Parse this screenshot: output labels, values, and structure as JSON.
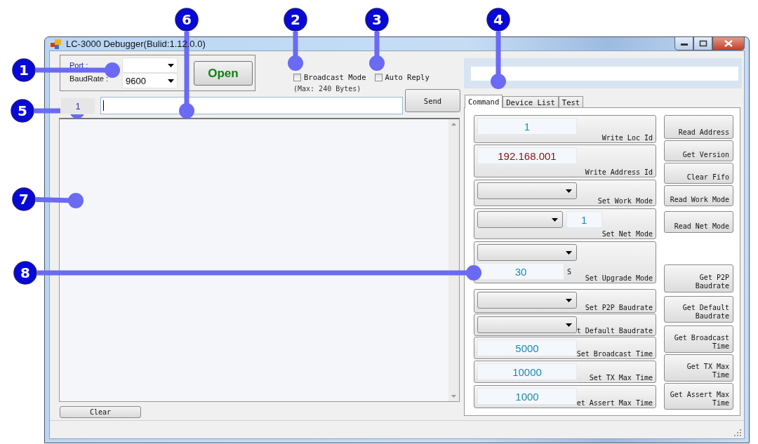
{
  "window": {
    "title": "LC-3000 Debugger(Bulid:1.12.0.0)"
  },
  "callouts": [
    {
      "label": "1"
    },
    {
      "label": "2"
    },
    {
      "label": "3"
    },
    {
      "label": "4"
    },
    {
      "label": "5"
    },
    {
      "label": "6"
    },
    {
      "label": "7"
    },
    {
      "label": "8"
    }
  ],
  "connection": {
    "port_label": "Port :",
    "baudrate_label": "BaudRate :",
    "baudrate_value": "9600",
    "open_button": "Open"
  },
  "options": [
    {
      "label": "Broadcast Mode",
      "checked": false
    },
    {
      "label": "Auto Reply",
      "checked": false
    }
  ],
  "max_note": "(Max: 240 Bytes)",
  "send_row": {
    "counter": "1",
    "send_button": "Send"
  },
  "clear_button": "Clear",
  "tabs": [
    {
      "label": "Command",
      "selected": true
    },
    {
      "label": "Device List",
      "selected": false
    },
    {
      "label": "Test",
      "selected": false
    }
  ],
  "commands": [
    {
      "kind": "input",
      "value": "1",
      "color": "#1a8ab0",
      "label": "Write Loc Id"
    },
    {
      "kind": "input",
      "value": "192.168.001",
      "color": "#8b1010",
      "label": "Write Address Id"
    },
    {
      "kind": "combo",
      "label": "Set Work Mode"
    },
    {
      "kind": "combo-input",
      "value": "1",
      "color": "#1a8ab0",
      "label": "Set Net Mode"
    },
    {
      "kind": "combo-unit",
      "value": "30",
      "unit": "S",
      "color": "#1a8ab0",
      "label": "Set Upgrade Mode"
    },
    {
      "kind": "combo",
      "label": "Set P2P Baudrate"
    },
    {
      "kind": "combo",
      "label": "t Default Baudrate"
    },
    {
      "kind": "input",
      "value": "5000",
      "color": "#1a8ab0",
      "label": "Set Broadcast Time"
    },
    {
      "kind": "input",
      "value": "10000",
      "color": "#1a8ab0",
      "label": "Set TX Max Time"
    },
    {
      "kind": "input",
      "value": "1000",
      "color": "#1a8ab0",
      "label": "et Assert Max Time"
    }
  ],
  "buttons": [
    "Read Address",
    "Get Version",
    "Clear Fifo",
    "Read Work Mode",
    "Read Net Mode",
    "Get P2P Baudrate",
    "Get Default Baudrate",
    "Get Broadcast Time",
    "Get TX Max Time",
    "Get Assert Max Time"
  ]
}
